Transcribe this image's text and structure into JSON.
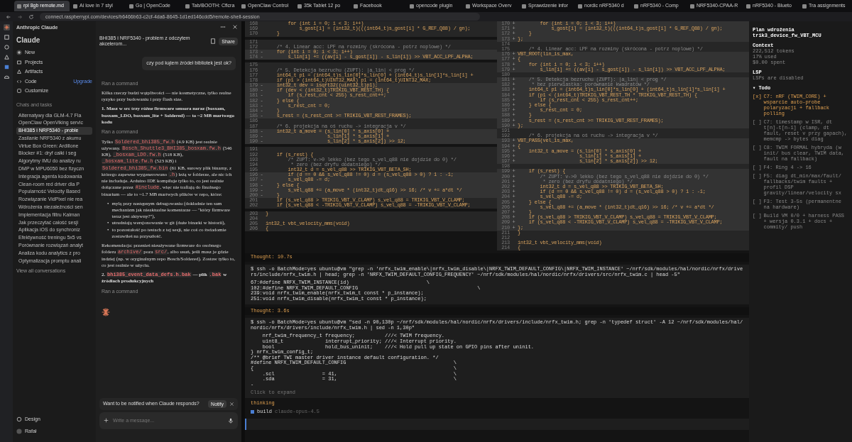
{
  "browser": {
    "tabs": [
      {
        "label": "rpi 8gb remote.md",
        "selected": true
      },
      {
        "label": "Ai love in 7 styl",
        "selected": false
      },
      {
        "label": "Go | OpenCode",
        "selected": false
      },
      {
        "label": "Tab/BOOTH: Cflcra",
        "selected": false
      },
      {
        "label": "OpenClaw Control",
        "selected": false
      },
      {
        "label": "35k Tablet 12 po",
        "selected": false
      },
      {
        "label": "Facebook",
        "selected": false
      },
      {
        "label": "opencode plugin",
        "selected": false
      },
      {
        "label": "Workspace Overv",
        "selected": false
      },
      {
        "label": "Sprawdzenie infor",
        "selected": false
      },
      {
        "label": "nordic nRF5340 d",
        "selected": false
      },
      {
        "label": "nRF5340 - Comp",
        "selected": false
      },
      {
        "label": "NRF5340-CPAA-R",
        "selected": false
      },
      {
        "label": "nRF5340 - Blueto",
        "selected": false
      },
      {
        "label": "Tra assignments",
        "selected": false
      }
    ],
    "address": "connect.raspberrypi.com/devices/b6466b63-c2cf-4da6-8645-1d1ed146cdd5/remote-shell-session"
  },
  "sidebar": {
    "org": "Anthropic Claude",
    "brand": "Claude",
    "nav": [
      {
        "label": "New",
        "kind": "new"
      },
      {
        "label": "Projects",
        "kind": "projects"
      },
      {
        "label": "Artifacts",
        "kind": "artifacts"
      },
      {
        "label": "Code",
        "kind": "code",
        "badge": "Upgrade"
      },
      {
        "label": "Customize",
        "kind": "customize"
      }
    ],
    "section": "Chats and tasks",
    "chats": [
      {
        "title": "Alternatywy dla GLM-4.7 Fla",
        "selected": false
      },
      {
        "title": "OpenClaw OpenViking servic",
        "selected": false
      },
      {
        "title": "BHI385 i NRF5340 - proble",
        "selected": true
      },
      {
        "title": "Zasilanie NRF5340 z akumu",
        "selected": false
      },
      {
        "title": "Virtue Box Green: Ardillone",
        "selected": false
      },
      {
        "title": "Blocker #1: dryf całki i seg",
        "selected": false
      },
      {
        "title": "Algorytmy IMU do analizy ru",
        "selected": false
      },
      {
        "title": "DMP w MPU6050 bez fizyczn",
        "selected": false
      },
      {
        "title": "Integracja agenta kodowania",
        "selected": false
      },
      {
        "title": "Clean-room red driver dla P",
        "selected": false
      },
      {
        "title": "Popularność Velocity Based",
        "selected": false
      },
      {
        "title": "Rozwiązanie VidPixel nie rea",
        "selected": false
      },
      {
        "title": "Wdrożenia niezależności sen",
        "selected": false
      },
      {
        "title": "Implementacja filtru Kalman",
        "selected": false
      },
      {
        "title": "Jak przeczytać całość sesji",
        "selected": false
      },
      {
        "title": "Aplikacja iOS do synchroniz",
        "selected": false
      },
      {
        "title": "Efektywność treningu 5x5 vs",
        "selected": false
      },
      {
        "title": "Porównanie rozwiązań analyt",
        "selected": false
      },
      {
        "title": "Analiza kodu analytics z pro",
        "selected": false
      },
      {
        "title": "Optymalizacja promptu anali",
        "selected": false
      }
    ],
    "view_all": "View all conversations",
    "design": "Design",
    "user": "Rafał"
  },
  "chat": {
    "title": "BHI385 i NRF5340 - problem z odczytem akcelerom...",
    "share": "Share",
    "messages": [
      {
        "kind": "user",
        "text": "czy pod kątem źródeł bibliotek jest ok?"
      },
      {
        "kind": "status",
        "text": "Ran a command"
      },
      {
        "kind": "para",
        "segments": [
          {
            "text": "Kilka rzeczy budzi wątpliwości — nie kosmetyczne, tylko realne ryzyko przy budowaniu i przy flash size."
          }
        ]
      },
      {
        "kind": "heading",
        "segments": [
          {
            "text": "1. Masz w src trzy różne firmware sensora naraz (bosxam, bosxam_LDO, bosxam_lite + Soldered) — to ~2 MB martwego kodu"
          }
        ]
      },
      {
        "kind": "status",
        "text": "Ran a command"
      },
      {
        "kind": "para",
        "segments": [
          {
            "text": "Tylko "
          },
          {
            "text": "Soldered_bhi385_fw.h",
            "code": true
          },
          {
            "text": " (4.9 KB) jest realnie używany. "
          },
          {
            "text": "Bosch_Shuttle3_BHI385_bosxam.fw.h",
            "code": true
          },
          {
            "text": " (546 KB), "
          },
          {
            "text": "_bosxam_LDO.fw.h",
            "code": true
          },
          {
            "text": " (518 KB), "
          },
          {
            "text": "_bosxam_lite.fw.h",
            "code": true
          },
          {
            "text": " (523 KB) i "
          },
          {
            "text": "Soldered_bhi385_fw.bin",
            "code": true
          },
          {
            "text": " (61 KB, surowy plik binarny, z którego zapewne wygenerowano "
          },
          {
            "text": ".h",
            "code": true
          },
          {
            "text": ") leżą w folderze, ale nic ich nie includuje. Arduino IDE kompiluje tylko to, co jest realnie dołączane przez "
          },
          {
            "text": "#include",
            "code": true
          },
          {
            "text": ", więc nie trafiają do finalnego binarium — ale to ~1.7 MB martwych plików w repo, które:"
          }
        ]
      },
      {
        "kind": "bullets",
        "items": [
          {
            "marker": "•",
            "text": "mylą przy następnym debugowaniu (dokładnie ten sam mechanizm jak nieaktualne komentarze — \"który firmware teraz jest aktywny?\"),"
          },
          {
            "marker": "•",
            "text": "utrudniają wersjonowanie w git (duże binarki w historii),"
          },
          {
            "marker": "•",
            "text": "to pozostałość po testach z tej sesji, nie coś co świadomie zostawiłeś na przyszłość."
          }
        ]
      },
      {
        "kind": "para",
        "segments": [
          {
            "text": "Rekomendacja: przenieś nieużywane firmware do osobnego folderu "
          },
          {
            "text": "archive/",
            "code": true
          },
          {
            "text": " poza "
          },
          {
            "text": "src/",
            "code": true
          },
          {
            "text": ", albo usuń, jeśli masz je gdzie indziej (np. w oryginalnym repo Bosch/Soldered). Zostaw tylko to, co jest realnie w użyciu."
          }
        ]
      },
      {
        "kind": "heading",
        "segments": [
          {
            "text": "2. "
          },
          {
            "text": "bhi385_event_data_defs.h.bak",
            "code": true
          },
          {
            "text": " — plik "
          },
          {
            "text": ".bak",
            "code": true
          },
          {
            "text": " w źródłach produkcyjnych"
          }
        ]
      },
      {
        "kind": "status",
        "text": "Ran a command"
      },
      {
        "kind": "spinner"
      }
    ],
    "notify": {
      "text": "Want to be notified when Claude responds?",
      "button": "Notify"
    },
    "input": {
      "placeholder": "Write a message..."
    }
  },
  "diff": {
    "left": [
      {
        "kind": "code",
        "num": "168",
        "text": "        for (int i = 0; i < 3; i++)",
        "changed": false
      },
      {
        "kind": "code",
        "num": "169",
        "text": "            s_gost[i] = (int32_t)(((int64_t)s_gost[i] * G_REF_Q88) / gn);",
        "changed": false
      },
      {
        "kind": "code",
        "num": "170",
        "text": "    }",
        "changed": false
      },
      {
        "kind": "gap"
      },
      {
        "kind": "code",
        "num": "171",
        "changed": false
      },
      {
        "kind": "comment",
        "num": "172",
        "text": "    /* 4. Linear acc: LPF na rozminy (skrócona - potrz noplowe) */",
        "changed": false
      },
      {
        "kind": "code",
        "num": "173",
        "marker": "-",
        "text": "    for (int i = 0; i < 3; i++)",
        "changed": true
      },
      {
        "kind": "code",
        "num": "174",
        "marker": "-",
        "text": "        s_lin[i] += ((av[i] - s_gost[i]) - s_lin[i]) >> VBT_ACC_LPF_ALPHA;",
        "changed": true
      },
      {
        "kind": "gap"
      },
      {
        "kind": "code",
        "num": "175",
        "changed": false
      },
      {
        "kind": "comment",
        "num": "176",
        "text": "    /* 5. Detekcja bezruchu (ZUPT): |a_lin| < prog */",
        "changed": false
      },
      {
        "kind": "code",
        "num": "177",
        "text": "    int64_t p1 = (int64_t)s_lin[0]*s_lin[0] + (int64_t)s_lin[1]*s_lin[1] +",
        "changed": false
      },
      {
        "kind": "code",
        "num": "178",
        "text": "    if (p1 > (int64_t)UINT32_MAX) p1 = (int64_t)UINT32_MAX;",
        "changed": false
      },
      {
        "kind": "code",
        "num": "179",
        "marker": "-",
        "text": "    int32_t dev = isqrt32((uint32_t)p1);",
        "changed": true
      },
      {
        "kind": "code",
        "num": "180",
        "marker": "-",
        "text": "    if (dev < (int32_t)TRIKIG_VBT_REST_TH) {",
        "changed": true
      },
      {
        "kind": "code",
        "num": "181",
        "marker": "-",
        "text": "        if (s_rest_cnt < 255) s_rest_cnt++;",
        "changed": true
      },
      {
        "kind": "code",
        "num": "182",
        "marker": "-",
        "text": "    } else {",
        "changed": true
      },
      {
        "kind": "code",
        "num": "183",
        "marker": "-",
        "text": "        s_rest_cnt = 0;",
        "changed": true
      },
      {
        "kind": "code",
        "num": "184",
        "marker": "-",
        "text": "    }",
        "changed": true
      },
      {
        "kind": "code",
        "num": "185",
        "marker": "-",
        "text": "    s_rest = (s_rest_cnt >= TRIKIG_VBT_REST_FRAMES);",
        "changed": true
      },
      {
        "kind": "code",
        "num": "186",
        "changed": false
      },
      {
        "kind": "comment",
        "num": "187",
        "text": "    /* 6. projekcja na oś ruchu -> integracja v */",
        "changed": false
      },
      {
        "kind": "code",
        "num": "188",
        "marker": "-",
        "text": "    int32_t a_move = (s_lin[0] * s_axis[0] +",
        "changed": true
      },
      {
        "kind": "code",
        "num": "189",
        "marker": "-",
        "text": "                      s_lin[1] * s_axis[1] +",
        "changed": true
      },
      {
        "kind": "code",
        "num": "190",
        "marker": "-",
        "text": "                      s_lin[2] * s_axis[2]) >> 12;",
        "changed": true
      },
      {
        "kind": "gap"
      },
      {
        "kind": "code",
        "num": "191",
        "changed": false
      },
      {
        "kind": "code",
        "num": "192",
        "text": "    if (s_rest) {",
        "changed": false
      },
      {
        "kind": "comment",
        "num": "193",
        "text": "        /* ZUPT: v->0 lekko (bez tego s_vel_q88 nie dojdzie do 0) */",
        "changed": false
      },
      {
        "kind": "comment",
        "num": "194",
        "text": "         * zero (bez dryfu dodatniego) */",
        "changed": false
      },
      {
        "kind": "code",
        "num": "195",
        "text": "        int32_t d = s_vel_q88 >> TRIKIG_VBT_BETA_SH;",
        "changed": false
      },
      {
        "kind": "code",
        "num": "196",
        "marker": "-",
        "text": "        if (d == 0 && s_vel_q88 != 0) d = (s_vel_q88 > 0) ? 1 : -1;",
        "changed": true
      },
      {
        "kind": "code",
        "num": "197",
        "marker": "-",
        "text": "        s_vel_q88 -= d;",
        "changed": true
      },
      {
        "kind": "code",
        "num": "198",
        "marker": "-",
        "text": "    } else {",
        "changed": true
      },
      {
        "kind": "code",
        "num": "199",
        "marker": "-",
        "text": "        s_vel_q88 += (a_move * (int32_t)dt_q16) >> 16; /* v += a*dt */",
        "changed": true
      },
      {
        "kind": "code",
        "num": "200",
        "marker": "-",
        "text": "    }",
        "changed": true
      },
      {
        "kind": "code",
        "num": "201",
        "text": "    if (s_vel_q88 > TRIKIG_VBT_V_CLAMP) s_vel_q88 = TRIKIG_VBT_V_CLAMP;",
        "changed": false
      },
      {
        "kind": "code",
        "num": "202",
        "text": "    if (s_vel_q88 < -TRIKIG_VBT_V_CLAMP) s_vel_q88 = -TRIKIG_VBT_V_CLAMP;",
        "changed": false
      },
      {
        "kind": "gap"
      },
      {
        "kind": "code",
        "num": "203",
        "text": "}",
        "changed": false
      },
      {
        "kind": "code",
        "num": "204",
        "changed": false
      },
      {
        "kind": "code",
        "num": "205",
        "text": "int32_t vbt_velocity_mms(void)",
        "changed": false
      },
      {
        "kind": "code",
        "num": "206",
        "text": "{",
        "changed": false
      }
    ],
    "right": [
      {
        "kind": "code",
        "num": "170",
        "marker": "+",
        "text": "        for (int i = 0; i < 3; i++)",
        "changed": true
      },
      {
        "kind": "code",
        "num": "171",
        "marker": "+",
        "text": "            s_gost[i] = (int32_t)(((int64_t)s_gost[i] * G_REF_Q88) / gn);",
        "changed": true
      },
      {
        "kind": "code",
        "num": "172",
        "marker": "+",
        "text": "    }",
        "changed": true
      },
      {
        "kind": "code",
        "num": "173",
        "marker": "+",
        "text": "};",
        "changed": true
      },
      {
        "kind": "code",
        "num": "174",
        "changed": false
      },
      {
        "kind": "comment",
        "num": "175",
        "text": "    /* 4. Linear acc: LPF na rozminy (skrócona - potrz noplowe) */",
        "changed": false
      },
      {
        "kind": "code",
        "num": "176",
        "marker": "+",
        "text": "VBT_ROOT(lin_is_max,",
        "changed": true
      },
      {
        "kind": "code",
        "num": "177",
        "marker": "+",
        "text": "{",
        "changed": true
      },
      {
        "kind": "code",
        "num": "178",
        "marker": "+",
        "text": "    for (int i = 0; i < 3; i++)",
        "changed": true
      },
      {
        "kind": "code",
        "num": "179",
        "marker": "+",
        "text": "        s_lin[i] += ((av[i] - s_gost[i]) - s_lin[i]) >> VBT_ACC_LPF_ALPHA;",
        "changed": true
      },
      {
        "kind": "code",
        "num": "180",
        "changed": false
      },
      {
        "kind": "comment",
        "num": "181",
        "marker": "+",
        "text": "    /* 5. Detekcja bezruchu (ZUPT): |a_lin| < prog */",
        "changed": true
      },
      {
        "kind": "comment",
        "num": "182",
        "marker": "+",
        "text": "     * bez pierwiastka: porównanie kwadratów */",
        "changed": true
      },
      {
        "kind": "code",
        "num": "183",
        "marker": "+",
        "text": "    int64_t p1 = (int64_t)s_lin[0]*s_lin[0] + (int64_t)s_lin[1]*s_lin[1] +",
        "changed": true
      },
      {
        "kind": "code",
        "num": "184",
        "marker": "+",
        "text": "    if (p1 < (int64_t)TRIKIG_VBT_REST_TH * TRIKIG_VBT_REST_TH) {",
        "changed": true
      },
      {
        "kind": "code",
        "num": "185",
        "marker": "+",
        "text": "        if (s_rest_cnt < 255) s_rest_cnt++;",
        "changed": true
      },
      {
        "kind": "code",
        "num": "186",
        "marker": "+",
        "text": "    } else {",
        "changed": true
      },
      {
        "kind": "code",
        "num": "187",
        "marker": "+",
        "text": "        s_rest_cnt = 0;",
        "changed": true
      },
      {
        "kind": "code",
        "num": "188",
        "marker": "+",
        "text": "    }",
        "changed": true
      },
      {
        "kind": "code",
        "num": "189",
        "marker": "+",
        "text": "    s_rest = (s_rest_cnt >= TRIKIG_VBT_REST_FRAMES);",
        "changed": true
      },
      {
        "kind": "code",
        "num": "190",
        "marker": "+",
        "text": "};",
        "changed": true
      },
      {
        "kind": "code",
        "num": "191",
        "changed": false
      },
      {
        "kind": "comment",
        "num": "192",
        "text": "    /* 6. projekcja na oś ruchu -> integracja v */",
        "changed": false
      },
      {
        "kind": "code",
        "num": "193",
        "marker": "+",
        "text": "VBT_PASS(vel_is_max,",
        "changed": true
      },
      {
        "kind": "code",
        "num": "194",
        "marker": "+",
        "text": "{",
        "changed": true
      },
      {
        "kind": "code",
        "num": "195",
        "marker": "+",
        "text": "    int32_t a_move = (s_lin[0] * s_axis[0] +",
        "changed": true
      },
      {
        "kind": "code",
        "num": "196",
        "marker": "+",
        "text": "                      s_lin[1] * s_axis[1] +",
        "changed": true
      },
      {
        "kind": "code",
        "num": "197",
        "marker": "+",
        "text": "                      s_lin[2] * s_axis[2]) >> 12;",
        "changed": true
      },
      {
        "kind": "code",
        "num": "198",
        "changed": false
      },
      {
        "kind": "code",
        "num": "199",
        "marker": "+",
        "text": "    if (s_rest) {",
        "changed": true
      },
      {
        "kind": "comment",
        "num": "200",
        "marker": "+",
        "text": "        /* ZUPT: v->0 lekko (bez tego s_vel_q88 nie dojdzie do 0) */",
        "changed": true
      },
      {
        "kind": "comment",
        "num": "201",
        "marker": "+",
        "text": "         * zero (bez dryfu dodatniego) */",
        "changed": true
      },
      {
        "kind": "code",
        "num": "202",
        "marker": "+",
        "text": "        int32_t d = s_vel_q88 >> TRIKIG_VBT_BETA_SH;",
        "changed": true
      },
      {
        "kind": "code",
        "num": "203",
        "marker": "+",
        "text": "        if (d == 0 && s_vel_q88 != 0) d = (s_vel_q88 > 0) ? 1 : -1;",
        "changed": true
      },
      {
        "kind": "code",
        "num": "204",
        "marker": "+",
        "text": "        s_vel_q88 -= d;",
        "changed": true
      },
      {
        "kind": "code",
        "num": "205",
        "marker": "+",
        "text": "    } else {",
        "changed": true
      },
      {
        "kind": "code",
        "num": "206",
        "marker": "+",
        "text": "        s_vel_q88 += (a_move * (int32_t)dt_q16) >> 16; /* v += a*dt */",
        "changed": true
      },
      {
        "kind": "code",
        "num": "207",
        "marker": "+",
        "text": "    }",
        "changed": true
      },
      {
        "kind": "code",
        "num": "208",
        "marker": "+",
        "text": "    if (s_vel_q88 > TRIKIG_VBT_V_CLAMP) s_vel_q88 = TRIKIG_VBT_V_CLAMP;",
        "changed": true
      },
      {
        "kind": "code",
        "num": "209",
        "marker": "+",
        "text": "    if (s_vel_q88 < -TRIKIG_VBT_V_CLAMP) s_vel_q88 = -TRIKIG_VBT_V_CLAMP;",
        "changed": true
      },
      {
        "kind": "code",
        "num": "210",
        "marker": "+",
        "text": "};",
        "changed": true
      },
      {
        "kind": "code",
        "num": "211",
        "text": "}",
        "changed": false
      },
      {
        "kind": "code",
        "num": "212",
        "changed": false
      },
      {
        "kind": "code",
        "num": "213",
        "text": "int32_t vbt_velocity_mms(void)",
        "changed": false
      },
      {
        "kind": "code",
        "num": "214",
        "text": "{",
        "changed": false
      }
    ]
  },
  "log": [
    {
      "kind": "thought",
      "text": "Thought: 10.7s"
    },
    {
      "kind": "command",
      "command": "$ ssh -o BatchMode=yes ubuntu@vm \"grep -n 'nrfx_twim_enable\\|nrfx_twim_disable\\|NRFX_TWIM_DEFAULT_CONFIG\\|NRFX_TWIM_INSTANCE' ~/nrf/sdk/modules/hal/nordic/nrfx/drivers/include/nrfx_twim.h | head; grep -n 'NRFX_TWIM_DEFAULT_CONFIG_FREQUENCY' ~/nrf/sdk/modules/hal/nordic/nrfx/drivers/src/nrfx_twim.c | head -5\"",
      "output": "67:#define NRFX_TWIM_INSTANCE(id)                          \\\n102:#define NRFX_TWIM_DEFAULT_CONFIG                                        \\\n239:void nrfx_twim_enable(nrfx_twim_t const * p_instance);\n251:void nrfx_twim_disable(nrfx_twim_t const * p_instance);"
    },
    {
      "kind": "thought",
      "text": "Thought: 3.6s"
    },
    {
      "kind": "command",
      "command": "$ ssh -o BatchMode=yes ubuntu@vm \"sed -n 90,130p ~/nrf/sdk/modules/hal/nordic/nrfx/drivers/include/nrfx_twim.h; grep -n 'typedef struct' -A 12 ~/nrf/sdk/modules/hal/nordic/nrfx/drivers/include/nrfx_twim.h | sed -n 1,30p\"",
      "output": "    nrf_twim_frequency_t frequency;          ///< TWIM frequency.\n    uint8_t              interrupt_priority; ///< Interrupt priority.\n    bool                 hold_bus_uninit;    ///< Hold pull up state on GPIO pins after uninit.\n} nrfx_twim_config_t;\n/** @brief TWI master driver instance default configuration. */\n#define NRFX_TWIM_DEFAULT_CONFIG                                    \\\n{                                                                   \\\n    .scl                = 41,                                       \\\n    .sda                = 31,                                       \\\n-",
      "expand": "Click to expand"
    },
    {
      "kind": "thinking",
      "text": "thinking"
    },
    {
      "kind": "agent",
      "name": "build",
      "model": "claude-opus-4.5"
    }
  ],
  "panel": {
    "title": "Plan wdrożenia",
    "subtitle": "trik3_device_fw_VBT_MCU",
    "context": {
      "label": "Context",
      "lines": [
        "222,512 tokens",
        "17% used",
        "$0.00 spent"
      ]
    },
    "lsp": {
      "label": "LSP",
      "text": "LSPs are disabled"
    },
    "todo": {
      "label": "▾ Todo",
      "items": [
        {
          "box": "[x]",
          "text": "C7: nRF (TWIM_CORE) + wsparcie auto-probe polaryzacji + fallback polling",
          "checked": true
        },
        {
          "box": "[ ]",
          "text": "C7: timestamp w ISR, dt t[n]-t[n-1] (clamp, dt fault, reset v przy gapach), memcmp -> bytes diag",
          "checked": false
        },
        {
          "box": "[ ]",
          "text": "C8: TWIM FORMAL hybryda (w init/ bus clear, TWIM data, fault na fallback)",
          "checked": false
        },
        {
          "box": "[ ]",
          "text": "F4: Ring 4 -> 16",
          "checked": false
        },
        {
          "box": "[ ]",
          "text": "F5: diag dt_min/max/fault/ fallbacks/twim faults + profil DSP gravity/linear/velocity sx",
          "checked": false
        },
        {
          "box": "[ ]",
          "text": "F3: Test 3-5s (permanentne na hardware)",
          "checked": false
        },
        {
          "box": "[ ]",
          "text": "Build VM 0/0 + harness PASS + wersja 0.3.1 + docs + commity/ push",
          "checked": false
        }
      ]
    }
  }
}
